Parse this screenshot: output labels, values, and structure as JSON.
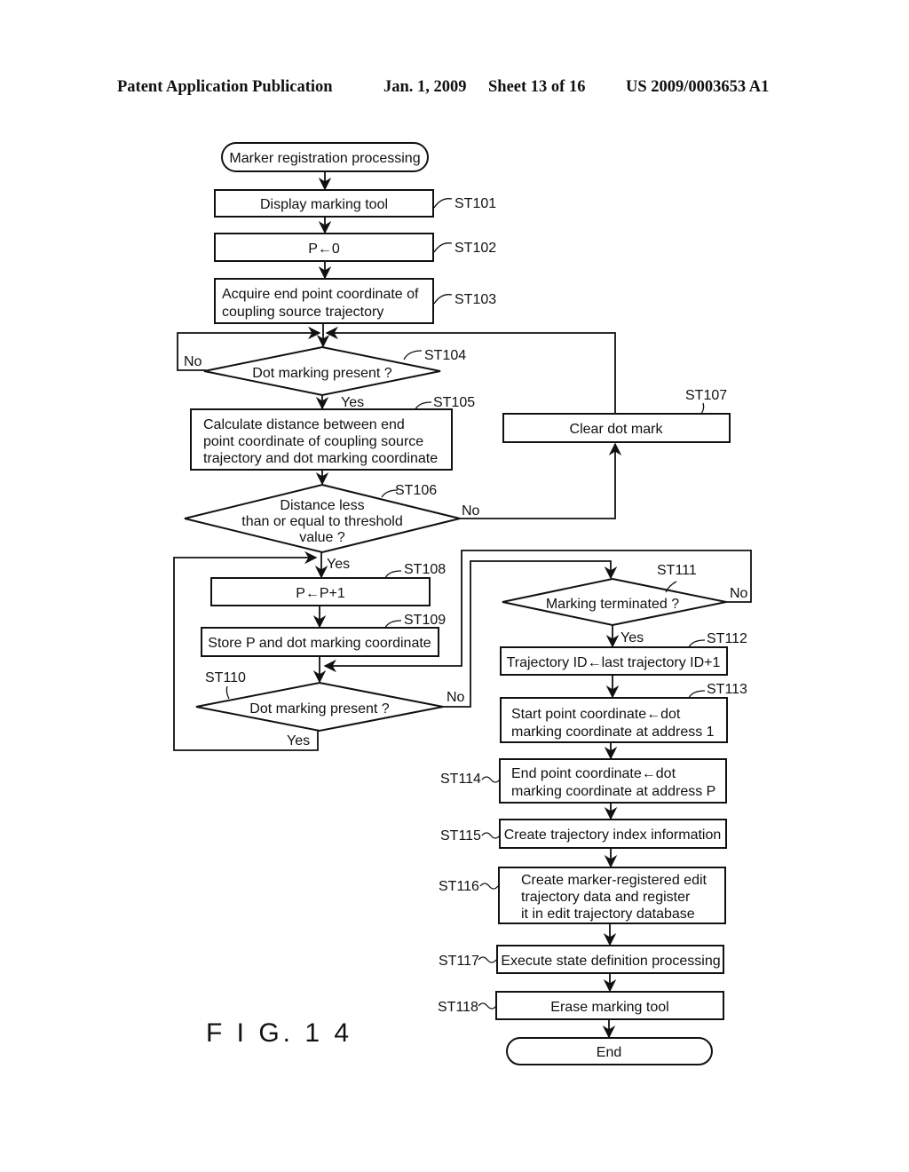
{
  "header": {
    "publication": "Patent Application Publication",
    "date": "Jan. 1, 2009",
    "sheet": "Sheet 13 of 16",
    "number": "US 2009/0003653 A1"
  },
  "figure_label": "F I G. 1 4",
  "flowchart": {
    "start": "Marker registration processing",
    "end": "End",
    "steps": {
      "st101": {
        "id": "ST101",
        "lines": [
          "Display marking tool"
        ]
      },
      "st102": {
        "id": "ST102",
        "lines": [
          "P←0"
        ]
      },
      "st103": {
        "id": "ST103",
        "lines": [
          "Acquire end point coordinate of",
          "coupling source trajectory"
        ]
      },
      "st104": {
        "id": "ST104",
        "lines": [
          "Dot marking present ?"
        ]
      },
      "st105": {
        "id": "ST105",
        "lines": [
          "Calculate distance between end",
          "point coordinate of coupling source",
          "trajectory and dot marking coordinate"
        ]
      },
      "st106": {
        "id": "ST106",
        "lines": [
          "Distance less",
          "than or equal to threshold",
          "value ?"
        ]
      },
      "st107": {
        "id": "ST107",
        "lines": [
          "Clear dot mark"
        ]
      },
      "st108": {
        "id": "ST108",
        "lines": [
          "P←P+1"
        ]
      },
      "st109": {
        "id": "ST109",
        "lines": [
          "Store P and dot marking coordinate"
        ]
      },
      "st110": {
        "id": "ST110",
        "lines": [
          "Dot marking present ?"
        ]
      },
      "st111": {
        "id": "ST111",
        "lines": [
          "Marking terminated ?"
        ]
      },
      "st112": {
        "id": "ST112",
        "lines": [
          "Trajectory ID←last trajectory ID+1"
        ]
      },
      "st113": {
        "id": "ST113",
        "lines": [
          "Start point coordinate←dot",
          "marking coordinate at address 1"
        ]
      },
      "st114": {
        "id": "ST114",
        "lines": [
          "End point coordinate←dot",
          "marking coordinate at address P"
        ]
      },
      "st115": {
        "id": "ST115",
        "lines": [
          "Create trajectory index information"
        ]
      },
      "st116": {
        "id": "ST116",
        "lines": [
          "Create marker-registered edit",
          "trajectory data and register",
          "it in edit trajectory database"
        ]
      },
      "st117": {
        "id": "ST117",
        "lines": [
          "Execute state definition processing"
        ]
      },
      "st118": {
        "id": "ST118",
        "lines": [
          "Erase marking tool"
        ]
      }
    },
    "branch_labels": {
      "yes": "Yes",
      "no": "No"
    }
  }
}
